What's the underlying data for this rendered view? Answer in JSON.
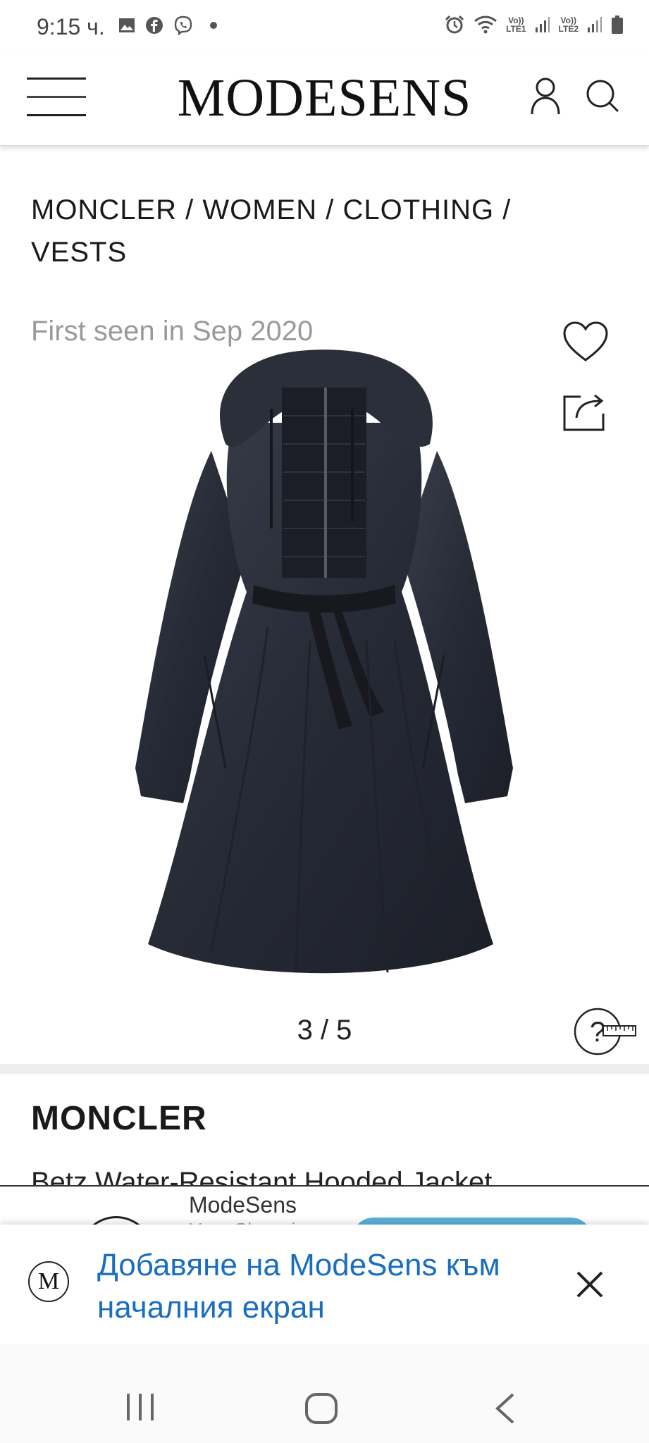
{
  "status_bar": {
    "time": "9:15 ч.",
    "left_icons": [
      "gallery-icon",
      "facebook-icon",
      "viber-icon",
      "dot-icon"
    ],
    "right_icons": [
      "alarm-icon",
      "wifi-icon",
      "signal-icon",
      "battery-icon"
    ],
    "sim1_label": "Vo)) LTE1",
    "sim2_label": "Vo)) LTE2"
  },
  "header": {
    "logo": "MODESENS",
    "icons": [
      "menu-icon",
      "user-icon",
      "search-icon"
    ]
  },
  "breadcrumb": {
    "text": "MONCLER / WOMEN / CLOTHING / VESTS"
  },
  "product": {
    "first_seen": "First seen in Sep 2020",
    "image_pager": "3 / 5",
    "brand": "MONCLER",
    "name": "Betz Water-Resistant Hooded Jacket"
  },
  "app_banner": {
    "app_name": "ModeSens",
    "subtitle": "Your Shopping"
  },
  "a2hs": {
    "logo_letter": "M",
    "message": "Добавяне на ModeSens към началния екран"
  },
  "colors": {
    "link_blue": "#1a6ec0",
    "muted_grey": "#9a9a9a",
    "banner_button": "#5ab0d8"
  }
}
